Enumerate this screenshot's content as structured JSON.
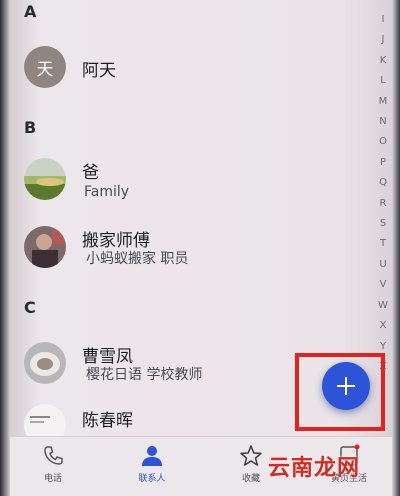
{
  "sections": [
    {
      "letter": "A"
    },
    {
      "letter": "B"
    },
    {
      "letter": "C"
    }
  ],
  "contacts": [
    {
      "name": "阿天",
      "subtitle": "",
      "avatar_initial": "天"
    },
    {
      "name": "爸",
      "subtitle": "Family"
    },
    {
      "name": "搬家师傅",
      "subtitle": "小蚂蚁搬家  职员"
    },
    {
      "name": "曹雪凤",
      "subtitle": "樱花日语  学校教师"
    },
    {
      "name": "陈春晖",
      "subtitle": ""
    }
  ],
  "alpha_index": [
    "I",
    "J",
    "K",
    "L",
    "M",
    "N",
    "O",
    "P",
    "Q",
    "R",
    "S",
    "T",
    "U",
    "V",
    "W",
    "X",
    "Y",
    "Z"
  ],
  "fab": {
    "icon": "plus-icon",
    "color": "#2c54d8"
  },
  "highlight_color": "#e3221b",
  "bottom_nav": {
    "items": [
      {
        "label": "电话",
        "icon": "phone-icon"
      },
      {
        "label": "联系人",
        "icon": "contacts-icon",
        "active": true
      },
      {
        "label": "收藏",
        "icon": "star-icon"
      },
      {
        "label": "黄页生活",
        "icon": "yellow-pages-icon"
      }
    ]
  },
  "watermark": "云南龙网"
}
